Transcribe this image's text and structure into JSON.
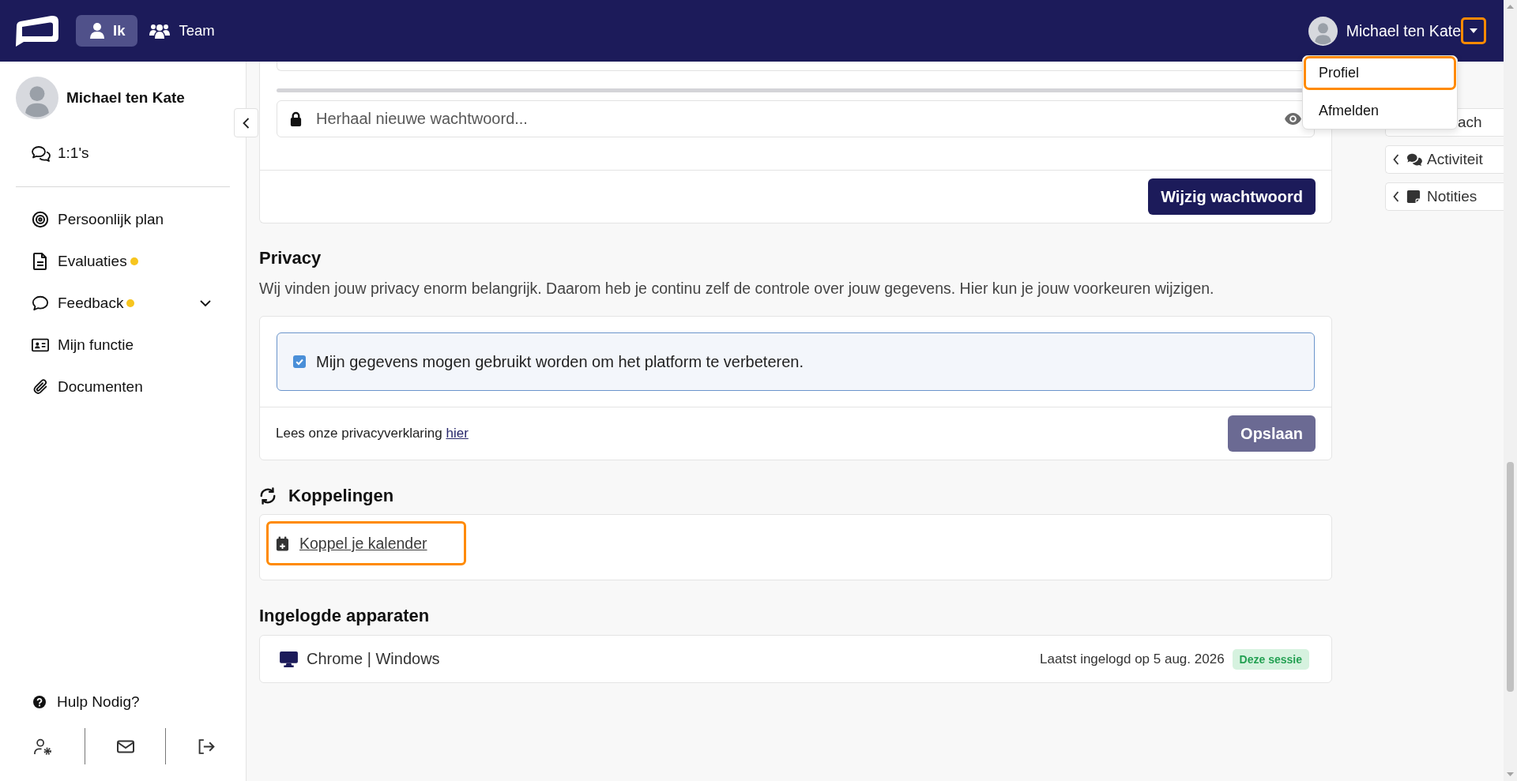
{
  "header": {
    "nav": [
      {
        "label": "Ik",
        "selected": true
      },
      {
        "label": "Team",
        "selected": false
      }
    ],
    "user": {
      "name": "Michael ten Kate",
      "caret_highlighted": true,
      "menu_open": true
    }
  },
  "user_menu": {
    "items": [
      {
        "label": "Profiel",
        "highlighted": true
      },
      {
        "label": "Afmelden",
        "highlighted": false
      }
    ]
  },
  "sidebar": {
    "profile": {
      "name": "Michael ten Kate"
    },
    "top_items": [
      {
        "label": "1:1's"
      }
    ],
    "items": [
      {
        "label": "Persoonlijk plan",
        "kind": "link",
        "notify": false
      },
      {
        "label": "Evaluaties",
        "kind": "link",
        "notify": true
      },
      {
        "label": "Feedback",
        "kind": "group",
        "notify": true,
        "expanded": false
      },
      {
        "label": "Mijn functie",
        "kind": "link",
        "notify": false
      },
      {
        "label": "Documenten",
        "kind": "link",
        "notify": false
      }
    ],
    "help": {
      "label": "Hulp Nodig?"
    }
  },
  "side_tabs": [
    {
      "label": "ach",
      "covered": true
    },
    {
      "label": "Activiteit",
      "covered": false
    },
    {
      "label": "Notities",
      "covered": false
    }
  ],
  "password_card": {
    "strength": {
      "level": 0
    },
    "repeat_field": {
      "placeholder": "Herhaal nieuwe wachtwoord..."
    },
    "submit": {
      "label": "Wijzig wachtwoord",
      "disabled": false
    }
  },
  "privacy": {
    "title": "Privacy",
    "description": "Wij vinden jouw privacy enorm belangrijk. Daarom heb je continu zelf de controle over jouw gegevens. Hier kun je jouw voorkeuren wijzigen.",
    "consent": {
      "label": "Mijn gegevens mogen gebruikt worden om het platform te verbeteren.",
      "checked": true
    },
    "footer_text": "Lees onze privacyverklaring",
    "footer_link": "hier",
    "save": {
      "label": "Opslaan",
      "disabled": true
    }
  },
  "integrations": {
    "title": "Koppelingen",
    "links": [
      {
        "label": "Koppel je kalender",
        "highlighted": true
      }
    ]
  },
  "devices": {
    "title": "Ingelogde apparaten",
    "items": [
      {
        "name": "Chrome | Windows",
        "last_login": "Laatst ingelogd op 5 aug. 2026",
        "badge": "Deze sessie"
      }
    ]
  }
}
